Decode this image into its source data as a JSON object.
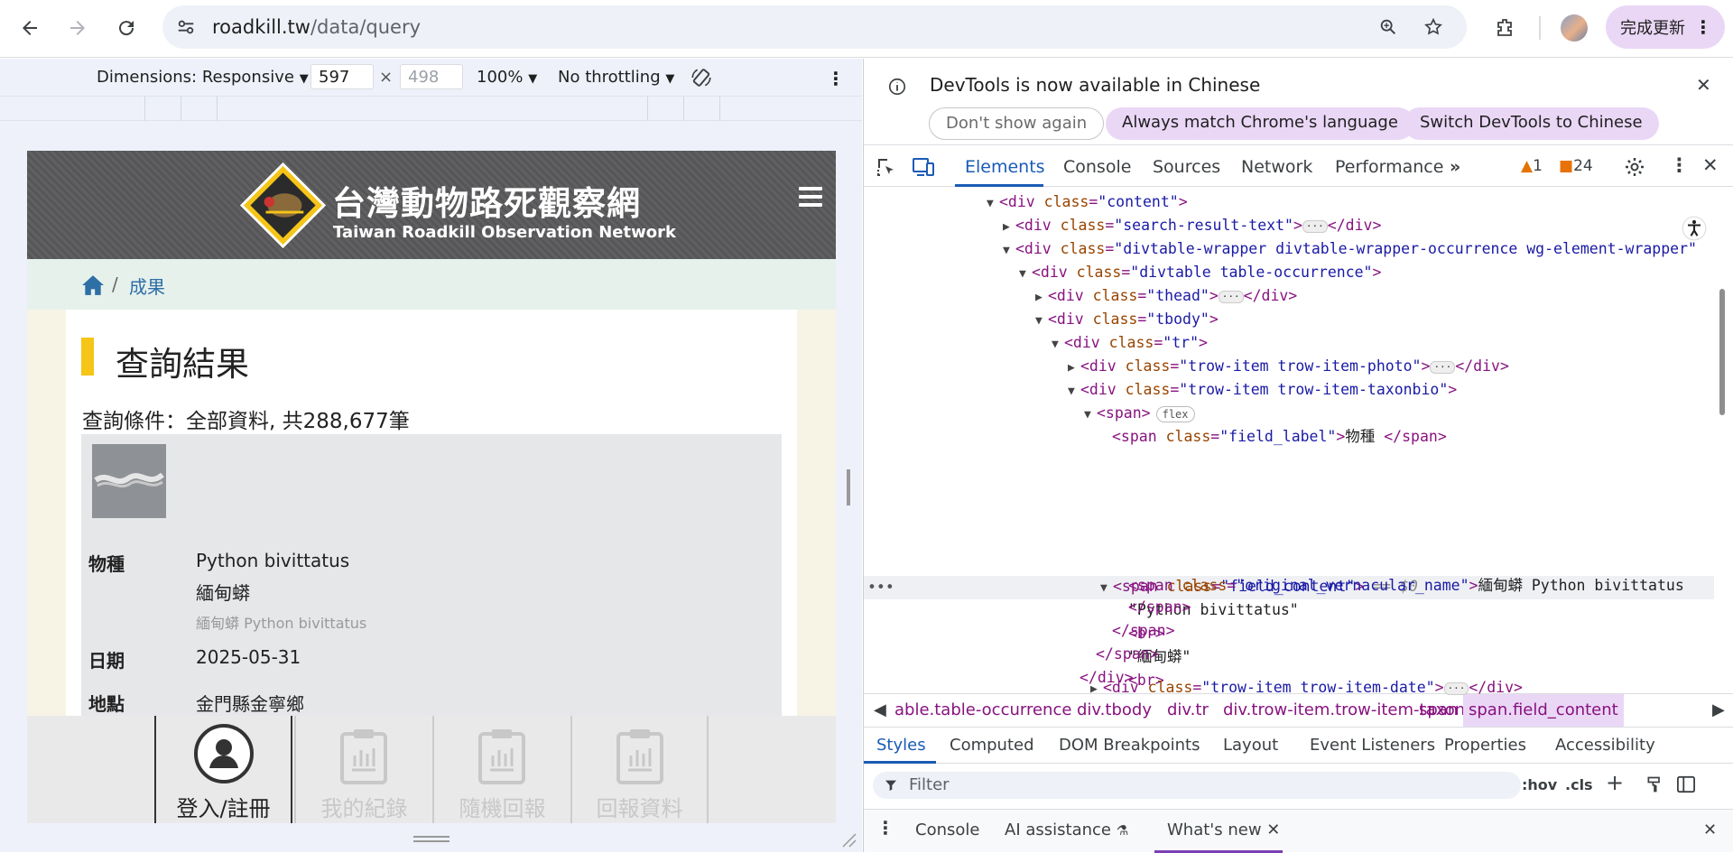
{
  "browser": {
    "url_host": "roadkill.tw",
    "url_path": "/data/query",
    "update_button": "完成更新"
  },
  "device_toolbar": {
    "dimensions_label": "Dimensions: Responsive",
    "width": "597",
    "height": "498",
    "zoom": "100%",
    "throttling": "No throttling"
  },
  "site": {
    "title_zh": "台灣動物路死觀察網",
    "title_en": "Taiwan Roadkill Observation Network",
    "breadcrumb_link": "成果",
    "breadcrumb_sep": "/",
    "page_title": "查詢結果",
    "query_text": "查詢條件：全部資料, 共288,677筆",
    "record": {
      "species_label": "物種",
      "species_sci": "Python bivittatus",
      "species_zh": "緬甸蟒",
      "species_original": "緬甸蟒 Python bivittatus",
      "date_label": "日期",
      "date_value": "2025-05-31",
      "place_label": "地點",
      "place_value": "金門縣金寧鄉"
    },
    "bottom_nav": [
      {
        "label": "登入/註冊",
        "active": true
      },
      {
        "label": "我的紀錄",
        "active": false
      },
      {
        "label": "隨機回報",
        "active": false
      },
      {
        "label": "回報資料",
        "active": false
      }
    ]
  },
  "devtools": {
    "notice": "DevTools is now available in Chinese",
    "notice_buttons": [
      "Don't show again",
      "Always match Chrome's language",
      "Switch DevTools to Chinese"
    ],
    "tabs": [
      "Elements",
      "Console",
      "Sources",
      "Network",
      "Performance"
    ],
    "warnings": "1",
    "errors": "24",
    "dom": {
      "content": "\"content\"",
      "search_result": "\"search-result-text\"",
      "wrapper": "\"divtable-wrapper divtable-wrapper-occurrence wg-element-wrapper\"",
      "divtable": "\"divtable table-occurrence\"",
      "thead": "\"thead\"",
      "tbody": "\"tbody\"",
      "tr": "\"tr\"",
      "photo": "\"trow-item trow-item-photo\"",
      "taxonbio": "\"trow-item trow-item-taxonbio\"",
      "flex_badge": "flex",
      "field_label": "\"field_label\"",
      "field_label_text": "物種 ",
      "field_content": "\"field_content\"",
      "selected_marker": "== $0",
      "text1": "\"Python bivittatus\"",
      "text2": "\"緬甸蟒\"",
      "orig_name": "\"original_vernacular_name\"",
      "orig_text": "緬甸蟒 Python bivittatus",
      "date_item": "\"trow-item trow-item-date\""
    },
    "crumbs": [
      "able.table-occurrence",
      "div.tbody",
      "div.tr",
      "div.trow-item.trow-item-taxonbio",
      "span",
      "span.field_content"
    ],
    "styles_tabs": [
      "Styles",
      "Computed",
      "DOM Breakpoints",
      "Layout",
      "Event Listeners",
      "Properties",
      "Accessibility"
    ],
    "filter_placeholder": "Filter",
    "filter_tools": [
      ":hov",
      ".cls"
    ],
    "drawer_tabs": [
      "Console",
      "AI assistance",
      "What's new"
    ]
  }
}
